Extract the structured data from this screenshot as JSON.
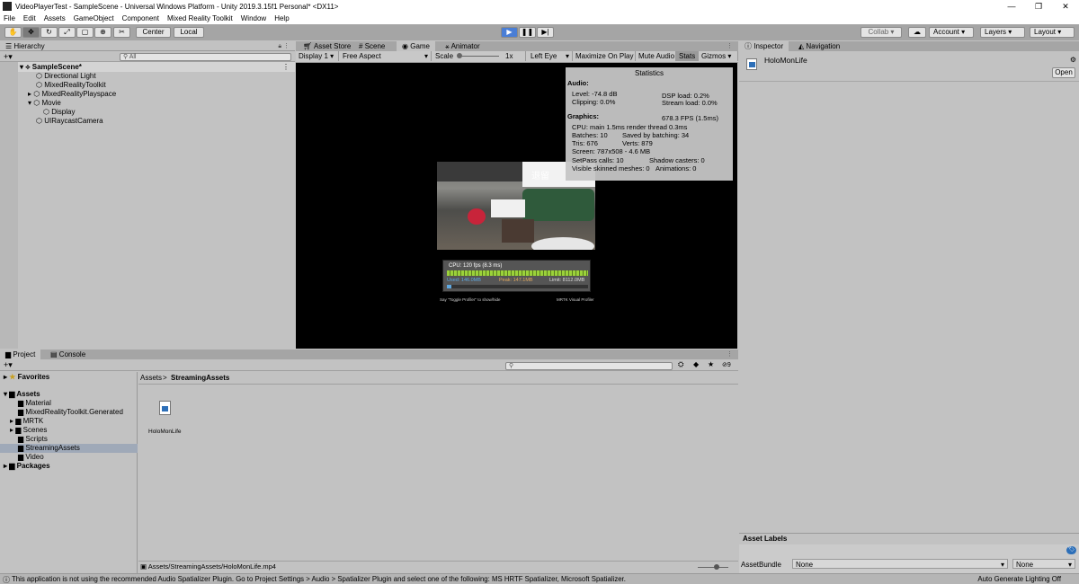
{
  "window": {
    "title": "VideoPlayerTest - SampleScene - Universal Windows Platform - Unity 2019.3.15f1 Personal* <DX11>",
    "controls": [
      "—",
      "❐",
      "✕"
    ]
  },
  "menu": [
    "File",
    "Edit",
    "Assets",
    "GameObject",
    "Component",
    "Mixed Reality Toolkit",
    "Window",
    "Help"
  ],
  "toolbar": {
    "center_label": "Center",
    "local_label": "Local",
    "collab_label": "Collab ▾",
    "account_label": "Account",
    "layers_label": "Layers",
    "layout_label": "Layout"
  },
  "hierarchy": {
    "tab": "Hierarchy",
    "search_placeholder": "All",
    "items": [
      {
        "label": "SampleScene*",
        "indent": 0
      },
      {
        "label": "Directional Light",
        "indent": 1
      },
      {
        "label": "MixedRealityToolkit",
        "indent": 1
      },
      {
        "label": "MixedRealityPlayspace",
        "indent": 1
      },
      {
        "label": "Movie",
        "indent": 1
      },
      {
        "label": "Display",
        "indent": 2
      },
      {
        "label": "UIRaycastCamera",
        "indent": 1
      }
    ]
  },
  "center_tabs": [
    "Asset Store",
    "Scene",
    "Game",
    "Animator"
  ],
  "game_toolbar": {
    "display": "Display 1",
    "aspect": "Free Aspect",
    "scale_label": "Scale",
    "scale_value": "1x",
    "eye": "Left Eye",
    "maximize": "Maximize On Play",
    "mute": "Mute Audio",
    "stats": "Stats",
    "gizmos": "Gizmos"
  },
  "statistics": {
    "title": "Statistics",
    "audio_header": "Audio:",
    "level": "Level: -74.8 dB",
    "clipping": "Clipping: 0.0%",
    "dsp_load": "DSP load: 0.2%",
    "stream_load": "Stream load: 0.0%",
    "graphics_header": "Graphics:",
    "fps": "678.3 FPS (1.5ms)",
    "cpu": "CPU: main 1.5ms  render thread 0.3ms",
    "batches": "Batches: 10",
    "saved_batching": "Saved by batching: 34",
    "tris": "Tris: 676",
    "verts": "Verts: 879",
    "screen": "Screen: 787x508 - 4.6 MB",
    "setpass": "SetPass calls: 10",
    "shadow_casters": "Shadow casters: 0",
    "skinned": "Visible skinned meshes: 0",
    "animations": "Animations: 0"
  },
  "video_overlay": {
    "exit_label": "退留",
    "cpu_text": "CPU: 120 fps (8.3 ms)",
    "used": "Used: 146.0MB",
    "peak": "Peak: 147.1MB",
    "limit": "Limit: 8112.0MB",
    "caption_left": "Say \"Toggle Profiler\" to show/hide",
    "caption_right": "MRTK Visual Profiler"
  },
  "inspector": {
    "tabs": [
      "Inspector",
      "Navigation"
    ],
    "object_name": "HoloMonLife",
    "open_button": "Open",
    "asset_labels": "Asset Labels",
    "asset_bundle_label": "AssetBundle",
    "asset_bundle_value": "None",
    "asset_bundle_variant": "None"
  },
  "project": {
    "tabs": [
      "Project",
      "Console"
    ],
    "search_placeholder": "",
    "hidden_count": "9",
    "favorites": "Favorites",
    "tree": [
      {
        "label": "Assets",
        "indent": 0,
        "bold": true
      },
      {
        "label": "Material",
        "indent": 1
      },
      {
        "label": "MixedRealityToolkit.Generated",
        "indent": 1
      },
      {
        "label": "MRTK",
        "indent": 1
      },
      {
        "label": "Scenes",
        "indent": 1
      },
      {
        "label": "Scripts",
        "indent": 1
      },
      {
        "label": "StreamingAssets",
        "indent": 1,
        "selected": true
      },
      {
        "label": "Video",
        "indent": 1
      },
      {
        "label": "Packages",
        "indent": 0,
        "bold": true
      }
    ],
    "breadcrumb_root": "Assets",
    "breadcrumb_sep": ">",
    "breadcrumb_current": "StreamingAssets",
    "file_name": "HoloMonLife",
    "selected_path": "Assets/StreamingAssets/HoloMonLife.mp4"
  },
  "status": {
    "message": "This application is not using the recommended Audio Spatializer Plugin. Go to Project Settings > Audio > Spatializer Plugin and select one of the following: MS HRTF Spatializer, Microsoft Spatializer.",
    "right": "Auto Generate Lighting Off"
  },
  "colors": {
    "play": "#4a7ed6",
    "selection": "#9fa9b8",
    "panel": "#c2c2c2"
  }
}
